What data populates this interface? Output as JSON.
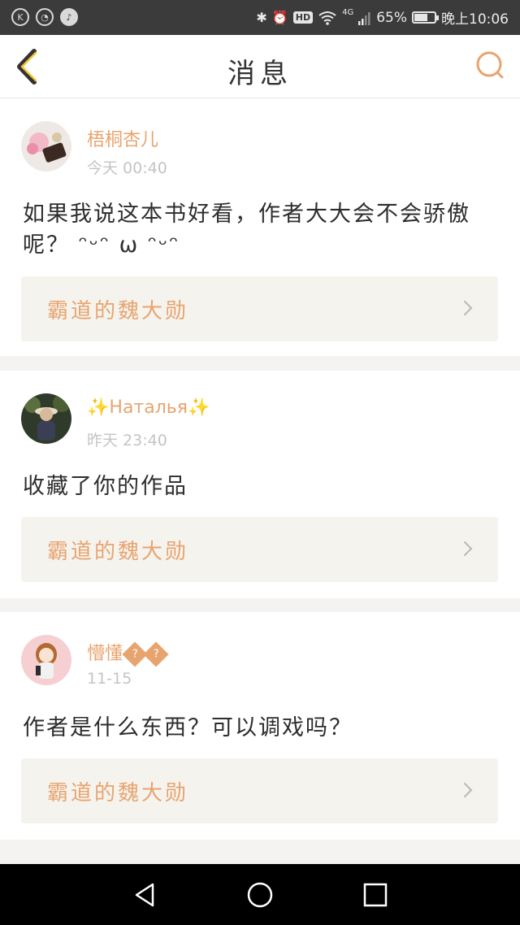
{
  "status_bar": {
    "left_icons": [
      {
        "icon": "k-app-icon",
        "glyph": "K"
      },
      {
        "icon": "wechat-icon",
        "glyph": "◔"
      },
      {
        "icon": "tiktok-icon",
        "glyph": "♪"
      }
    ],
    "network": "4G",
    "hd_label": "HD",
    "battery_percent": "65%",
    "battery_level": 0.65,
    "time": "晚上10:06"
  },
  "header": {
    "title": "消息",
    "back_icon": "chevron-left-icon",
    "search_icon": "search-icon",
    "accent_color": "#e8a46f"
  },
  "messages": [
    {
      "username": "梧桐杏儿",
      "timestamp": "今天 00:40",
      "text": "如果我说这本书好看，作者大大会不会骄傲呢？ ᵔᵕᵔ ω ᵔᵕᵔ",
      "book_title": "霸道的魏大勋"
    },
    {
      "username": "Наталья",
      "username_prefix": "✨",
      "username_suffix": "✨",
      "timestamp": "昨天 23:40",
      "text": "收藏了你的作品",
      "book_title": "霸道的魏大勋"
    },
    {
      "username": "懵懂",
      "username_suffix_marks": [
        "?",
        "?"
      ],
      "timestamp": "11-15",
      "text": "作者是什么东西？可以调戏吗？",
      "book_title": "霸道的魏大勋"
    }
  ],
  "nav_bar": {
    "back_icon": "triangle-back-icon",
    "home_icon": "circle-home-icon",
    "recents_icon": "square-recents-icon"
  }
}
